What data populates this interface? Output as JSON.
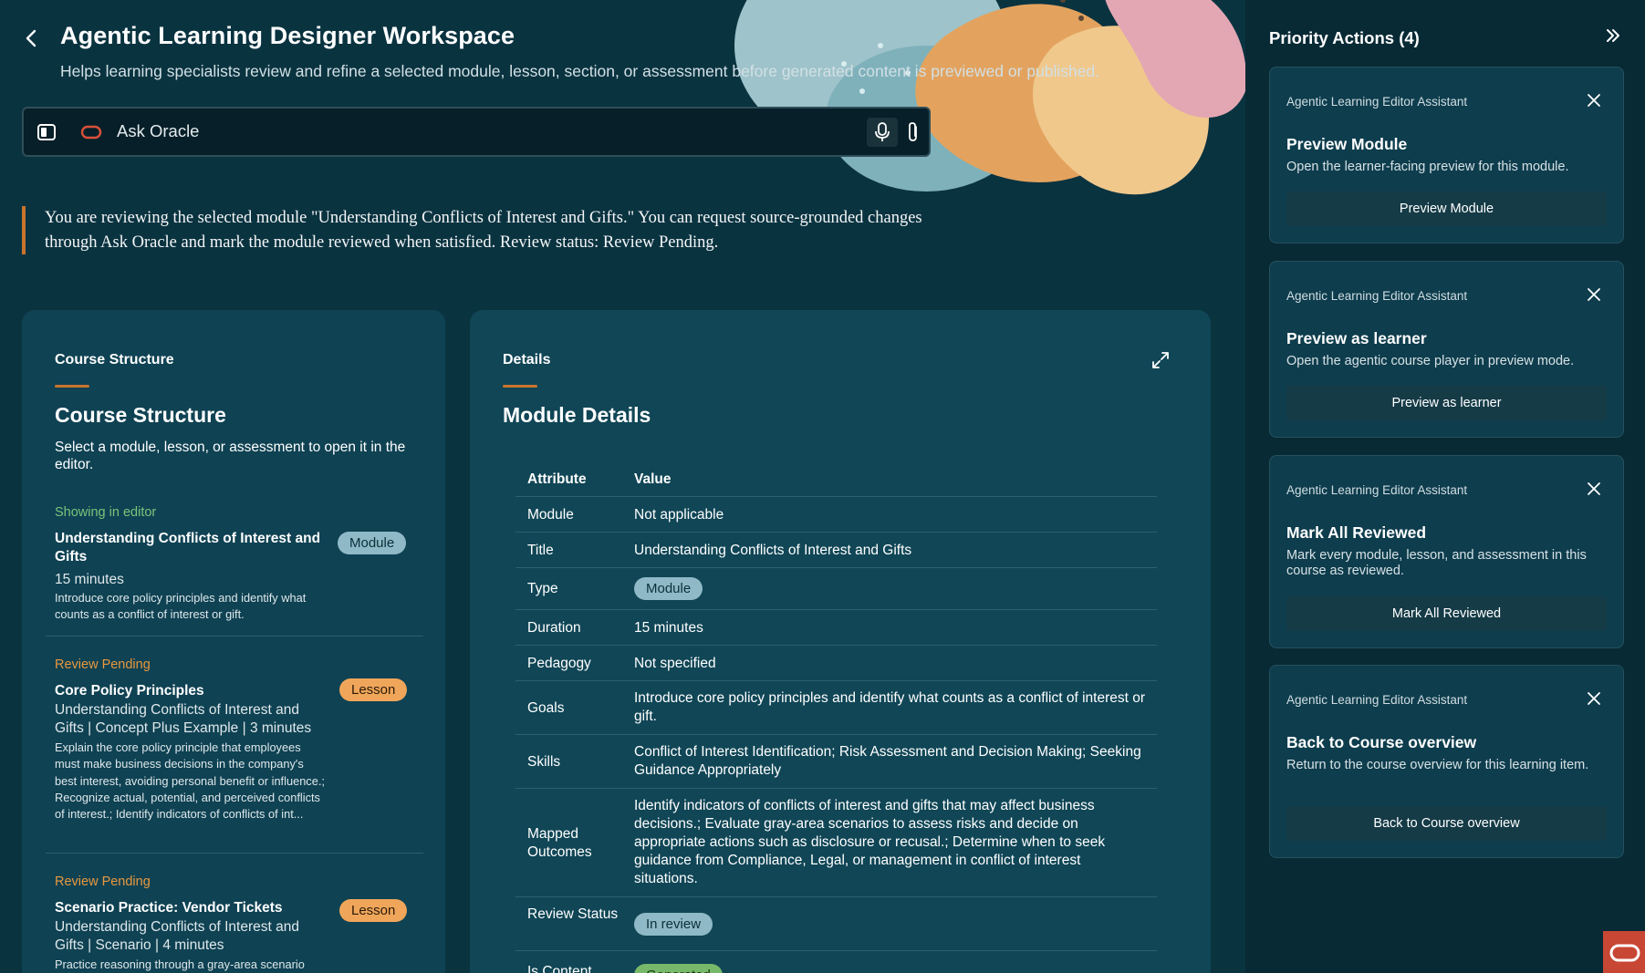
{
  "header": {
    "title": "Agentic Learning Designer Workspace",
    "subtitle": "Helps learning specialists review and refine a selected module, lesson, section, or assessment before generated content is previewed or published."
  },
  "ask": {
    "placeholder": "Ask Oracle"
  },
  "notice": "You are reviewing the selected module \"Understanding Conflicts of Interest and Gifts.\" You can request source-grounded changes through Ask Oracle and mark the module reviewed when satisfied. Review status: Review Pending.",
  "structure": {
    "tab": "Course Structure",
    "heading": "Course Structure",
    "description": "Select a module, lesson, or assessment to open it in the editor.",
    "items": [
      {
        "status": "Showing in editor",
        "title": "Understanding Conflicts of Interest and Gifts",
        "badge": "Module",
        "meta": "15 minutes",
        "desc": "Introduce core policy principles and identify what counts as a conflict of interest or gift."
      },
      {
        "status": "Review Pending",
        "title": "Core Policy Principles",
        "badge": "Lesson",
        "meta": "Understanding Conflicts of Interest and Gifts | Concept Plus Example | 3 minutes",
        "desc": "Explain the core policy principle that employees must make business decisions in the company's best interest, avoiding personal benefit or influence.; Recognize actual, potential, and perceived conflicts of interest.; Identify indicators of conflicts of int..."
      },
      {
        "status": "Review Pending",
        "title": "Scenario Practice: Vendor Tickets",
        "badge": "Lesson",
        "meta": "Understanding Conflicts of Interest and Gifts | Scenario | 4 minutes",
        "desc": "Practice reasoning through a gray-area scenario"
      }
    ]
  },
  "details": {
    "tab": "Details",
    "heading": "Module Details",
    "col_attr": "Attribute",
    "col_val": "Value",
    "rows": [
      {
        "attr": "Module",
        "val": "Not applicable"
      },
      {
        "attr": "Title",
        "val": "Understanding Conflicts of Interest and Gifts"
      },
      {
        "attr": "Type",
        "val": "Module"
      },
      {
        "attr": "Duration",
        "val": "15 minutes"
      },
      {
        "attr": "Pedagogy",
        "val": "Not specified"
      },
      {
        "attr": "Goals",
        "val": "Introduce core policy principles and identify what counts as a conflict of interest or gift."
      },
      {
        "attr": "Skills",
        "val": "Conflict of Interest Identification; Risk Assessment and Decision Making; Seeking Guidance Appropriately"
      },
      {
        "attr": "Mapped Outcomes",
        "val": "Identify indicators of conflicts of interest and gifts that may affect business decisions.; Evaluate gray-area scenarios to assess risks and decide on appropriate actions such as disclosure or recusal.; Determine when to seek guidance from Compliance, Legal, or management in conflict of interest situations."
      },
      {
        "attr": "Review Status",
        "val": "In review"
      },
      {
        "attr": "Is Content",
        "val": "Generated"
      }
    ]
  },
  "priority": {
    "title": "Priority Actions (4)",
    "cards": [
      {
        "source": "Agentic Learning Editor Assistant",
        "title": "Preview Module",
        "desc": "Open the learner-facing preview for this module.",
        "button": "Preview Module"
      },
      {
        "source": "Agentic Learning Editor Assistant",
        "title": "Preview as learner",
        "desc": "Open the agentic course player in preview mode.",
        "button": "Preview as learner"
      },
      {
        "source": "Agentic Learning Editor Assistant",
        "title": "Mark All Reviewed",
        "desc": "Mark every module, lesson, and assessment in this course as reviewed.",
        "button": "Mark All Reviewed"
      },
      {
        "source": "Agentic Learning Editor Assistant",
        "title": "Back to Course overview",
        "desc": "Return to the course overview for this learning item.",
        "button": "Back to Course overview"
      }
    ]
  },
  "colors": {
    "background": "#0a3340",
    "card": "#0f4253",
    "accent": "#c9742d",
    "status_green": "#7bc47a",
    "status_orange": "#e8983e",
    "oracle_red": "#c74634"
  }
}
